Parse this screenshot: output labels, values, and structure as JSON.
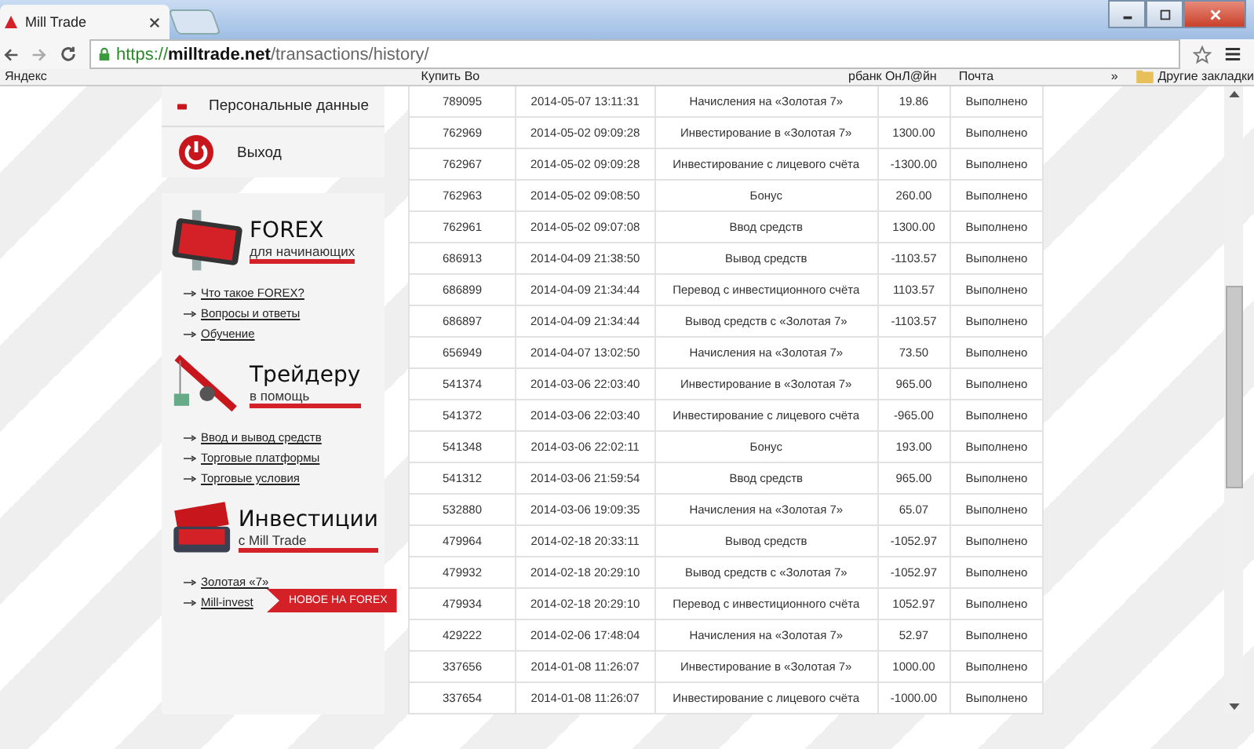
{
  "browser": {
    "tab_title": "Mill Trade",
    "url": {
      "scheme": "https://",
      "domain": "milltrade.net",
      "path": "/transactions/history/"
    },
    "bookmarks": [
      "Яндекс",
      "Купить Во",
      "рбанк ОнЛ@йн",
      "Почта"
    ],
    "more": "»",
    "other_bookmarks": "Другие закладки"
  },
  "sidebar": {
    "account_menu": [
      {
        "kind": "profile",
        "label": "Персональные данные"
      },
      {
        "kind": "exit",
        "label": "Выход"
      }
    ],
    "promos": [
      {
        "kind": "tablet",
        "title": "FOREX",
        "subtitle": "для начинающих",
        "links": [
          "Что такое FOREX?",
          "Вопросы и ответы",
          "Обучение"
        ]
      },
      {
        "kind": "rod",
        "title": "Трейдеру",
        "subtitle": "в помощь",
        "links": [
          "Ввод и вывод средств",
          "Торговые платформы",
          "Торговые условия"
        ]
      },
      {
        "kind": "case",
        "title": "Инвестиции",
        "subtitle": "с Mill Trade",
        "links": [
          "Золотая «7»",
          "Mill-invest"
        ]
      }
    ],
    "banner": "НОВОЕ НА FOREX"
  },
  "table": {
    "rows": [
      [
        "789095",
        "2014-05-07 13:11:31",
        "Начисления на «Золотая 7»",
        "19.86",
        "Выполнено"
      ],
      [
        "762969",
        "2014-05-02 09:09:28",
        "Инвестирование в «Золотая 7»",
        "1300.00",
        "Выполнено"
      ],
      [
        "762967",
        "2014-05-02 09:09:28",
        "Инвестирование с лицевого счёта",
        "-1300.00",
        "Выполнено"
      ],
      [
        "762963",
        "2014-05-02 09:08:50",
        "Бонус",
        "260.00",
        "Выполнено"
      ],
      [
        "762961",
        "2014-05-02 09:07:08",
        "Ввод средств",
        "1300.00",
        "Выполнено"
      ],
      [
        "686913",
        "2014-04-09 21:38:50",
        "Вывод средств",
        "-1103.57",
        "Выполнено"
      ],
      [
        "686899",
        "2014-04-09 21:34:44",
        "Перевод с инвестиционного счёта",
        "1103.57",
        "Выполнено"
      ],
      [
        "686897",
        "2014-04-09 21:34:44",
        "Вывод средств с «Золотая 7»",
        "-1103.57",
        "Выполнено"
      ],
      [
        "656949",
        "2014-04-07 13:02:50",
        "Начисления на «Золотая 7»",
        "73.50",
        "Выполнено"
      ],
      [
        "541374",
        "2014-03-06 22:03:40",
        "Инвестирование в «Золотая 7»",
        "965.00",
        "Выполнено"
      ],
      [
        "541372",
        "2014-03-06 22:03:40",
        "Инвестирование с лицевого счёта",
        "-965.00",
        "Выполнено"
      ],
      [
        "541348",
        "2014-03-06 22:02:11",
        "Бонус",
        "193.00",
        "Выполнено"
      ],
      [
        "541312",
        "2014-03-06 21:59:54",
        "Ввод средств",
        "965.00",
        "Выполнено"
      ],
      [
        "532880",
        "2014-03-06 19:09:35",
        "Начисления на «Золотая 7»",
        "65.07",
        "Выполнено"
      ],
      [
        "479964",
        "2014-02-18 20:33:11",
        "Вывод средств",
        "-1052.97",
        "Выполнено"
      ],
      [
        "479932",
        "2014-02-18 20:29:10",
        "Вывод средств с «Золотая 7»",
        "-1052.97",
        "Выполнено"
      ],
      [
        "479934",
        "2014-02-18 20:29:10",
        "Перевод с инвестиционного счёта",
        "1052.97",
        "Выполнено"
      ],
      [
        "429222",
        "2014-02-06 17:48:04",
        "Начисления на «Золотая 7»",
        "52.97",
        "Выполнено"
      ],
      [
        "337656",
        "2014-01-08 11:26:07",
        "Инвестирование в «Золотая 7»",
        "1000.00",
        "Выполнено"
      ],
      [
        "337654",
        "2014-01-08 11:26:07",
        "Инвестирование с лицевого счёта",
        "-1000.00",
        "Выполнено"
      ]
    ]
  }
}
